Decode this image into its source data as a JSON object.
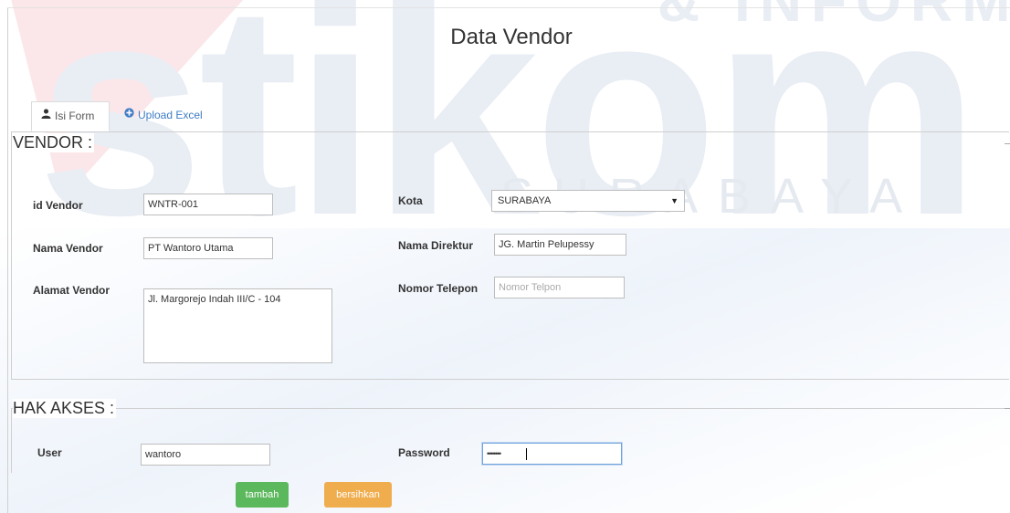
{
  "page": {
    "title": "Data Vendor"
  },
  "watermark": {
    "logo_text": "stikom",
    "top_text": "& INFORMATIKA",
    "city_text": "SURABAYA"
  },
  "tabs": [
    {
      "label": "Isi Form",
      "icon": "user-icon",
      "active": true
    },
    {
      "label": "Upload Excel",
      "icon": "plus-circle-icon",
      "active": false
    }
  ],
  "vendor": {
    "legend": "VENDOR :",
    "id_vendor": {
      "label": "id Vendor",
      "value": "WNTR-001"
    },
    "nama_vendor": {
      "label": "Nama Vendor",
      "value": "PT Wantoro Utama"
    },
    "alamat_vendor": {
      "label": "Alamat Vendor",
      "value": "Jl. Margorejo Indah III/C - 104"
    },
    "kota": {
      "label": "Kota",
      "value": "SURABAYA"
    },
    "nama_direktur": {
      "label": "Nama Direktur",
      "value": "JG. Martin Pelupessy"
    },
    "nomor_telepon": {
      "label": "Nomor Telepon",
      "value": "",
      "placeholder": "Nomor Telpon"
    }
  },
  "hak_akses": {
    "legend": "HAK AKSES :",
    "user": {
      "label": "User",
      "value": "wantoro"
    },
    "password": {
      "label": "Password",
      "value": "•••••••"
    }
  },
  "buttons": {
    "tambah": "tambah",
    "bersihkan": "bersihkan"
  },
  "colors": {
    "tambah": "#5cb85c",
    "bersihkan": "#f0ad4e",
    "link": "#3e7cc4"
  }
}
